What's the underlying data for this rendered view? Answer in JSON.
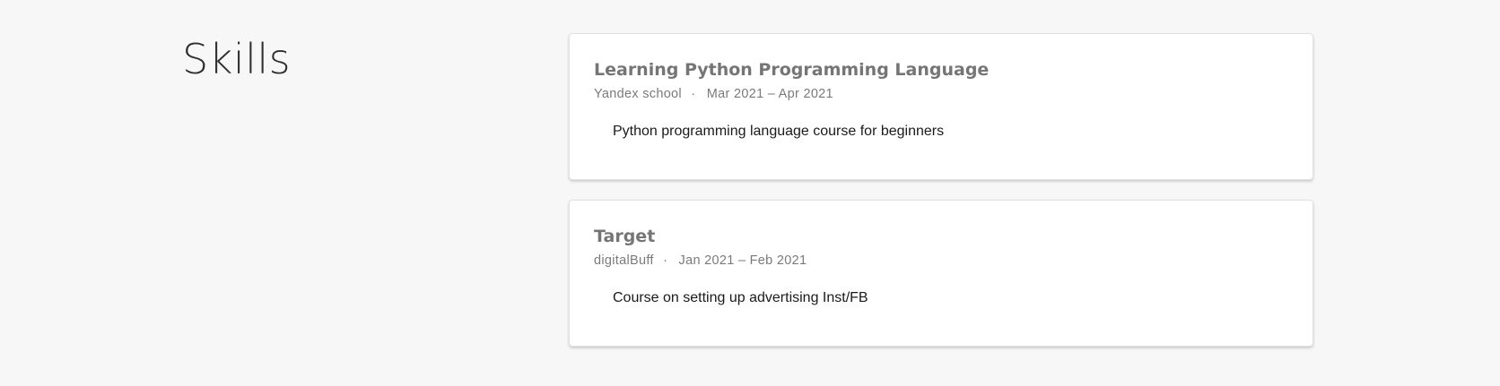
{
  "section": {
    "title": "Skills"
  },
  "entries": [
    {
      "title": "Learning Python Programming Language",
      "institution": "Yandex school",
      "separator": "·",
      "dates": "Mar 2021 – Apr 2021",
      "description": "Python programming language course for beginners"
    },
    {
      "title": "Target",
      "institution": "digitalBuff",
      "separator": "·",
      "dates": "Jan 2021 – Feb 2021",
      "description": "Course on setting up advertising Inst/FB"
    }
  ]
}
